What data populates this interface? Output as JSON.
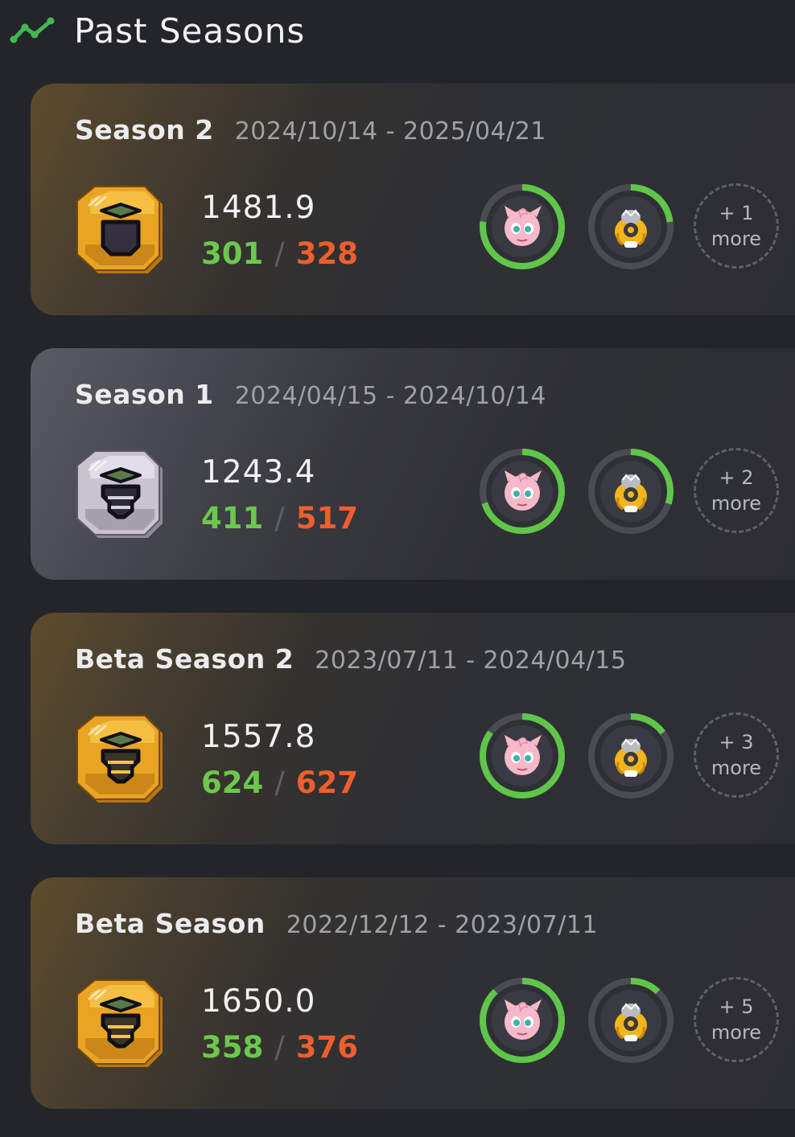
{
  "header": {
    "title": "Past Seasons",
    "icon": "trend-line-icon",
    "accent": "#3fb950"
  },
  "colors": {
    "wins": "#6cc84d",
    "losses": "#ef5e2d",
    "ring_track": "#4b4c53",
    "ring_fill": "#5fc64a"
  },
  "seasons": [
    {
      "name": "Season 2",
      "dates": "2024/10/14 - 2025/04/21",
      "rank_icon": "gold-rank-badge-icon",
      "rating": "1481.9",
      "wins": "301",
      "sep": "/",
      "losses": "328",
      "pokemon": [
        {
          "icon": "jigglypuff-icon",
          "ring_pct": 0.77
        },
        {
          "icon": "snorlax-icon",
          "ring_pct": 0.23
        }
      ],
      "more_count": "+ 1",
      "more_label": "more"
    },
    {
      "name": "Season 1",
      "dates": "2024/04/15 - 2024/10/14",
      "rank_icon": "silver-rank-badge-icon",
      "rating": "1243.4",
      "wins": "411",
      "sep": "/",
      "losses": "517",
      "pokemon": [
        {
          "icon": "jigglypuff-icon",
          "ring_pct": 0.7
        },
        {
          "icon": "snorlax-icon",
          "ring_pct": 0.3
        }
      ],
      "more_count": "+ 2",
      "more_label": "more"
    },
    {
      "name": "Beta Season 2",
      "dates": "2023/07/11 - 2024/04/15",
      "rank_icon": "gold-rank-badge-icon",
      "rating": "1557.8",
      "wins": "624",
      "sep": "/",
      "losses": "627",
      "pokemon": [
        {
          "icon": "jigglypuff-icon",
          "ring_pct": 0.85
        },
        {
          "icon": "snorlax-icon",
          "ring_pct": 0.15
        }
      ],
      "more_count": "+ 3",
      "more_label": "more"
    },
    {
      "name": "Beta Season",
      "dates": "2022/12/12 - 2023/07/11",
      "rank_icon": "gold-rank-badge-icon",
      "rating": "1650.0",
      "wins": "358",
      "sep": "/",
      "losses": "376",
      "pokemon": [
        {
          "icon": "jigglypuff-icon",
          "ring_pct": 0.88
        },
        {
          "icon": "snorlax-icon",
          "ring_pct": 0.12
        }
      ],
      "more_count": "+ 5",
      "more_label": "more"
    }
  ]
}
